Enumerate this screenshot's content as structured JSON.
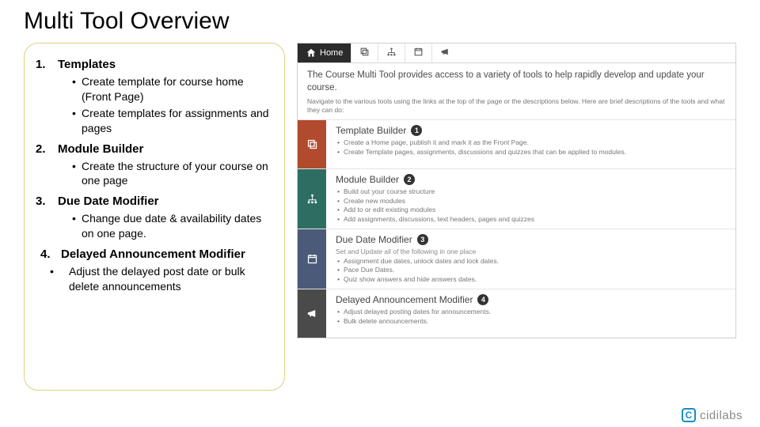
{
  "title": "Multi Tool Overview",
  "items": [
    {
      "num": "1.",
      "head": "Templates",
      "bullets": [
        "Create template for course home (Front Page)",
        "Create templates for assignments and pages"
      ]
    },
    {
      "num": "2.",
      "head": "Module Builder",
      "bullets": [
        "Create the structure of your course on one page"
      ]
    },
    {
      "num": "3.",
      "head": "Due Date Modifier",
      "bullets": [
        "Change due date & availability dates on one page."
      ]
    },
    {
      "num": "4.",
      "head": "Delayed Announcement Modifier",
      "bullets": [
        "Adjust the delayed post date or bulk delete announcements"
      ]
    }
  ],
  "screenshot": {
    "home_label": "Home",
    "intro": "The Course Multi Tool provides access to a variety of tools to help rapidly develop and update your course.",
    "subintro": "Navigate to the various tools using the links at the top of the page or the descriptions below. Here are brief descriptions of the tools and what they can do:",
    "sections": [
      {
        "title": "Template Builder",
        "badge": "1",
        "desc": "",
        "bullets": [
          "Create a Home page, publish it and mark it as the Front Page.",
          "Create Template pages, assignments, discussions and quizzes that can be applied to modules."
        ]
      },
      {
        "title": "Module Builder",
        "badge": "2",
        "desc": "",
        "bullets": [
          "Build out your course structure",
          "Create new modules",
          "Add to or edit existing modules",
          "Add assignments, discussions, text headers, pages and quizzes"
        ]
      },
      {
        "title": "Due Date Modifier",
        "badge": "3",
        "desc": "Set and Update all of the following in one place",
        "bullets": [
          "Assignment due dates, unlock dates and lock dates.",
          "Pace Due Dates.",
          "Quiz show answers and hide answers dates."
        ]
      },
      {
        "title": "Delayed Announcement Modifier",
        "badge": "4",
        "desc": "",
        "bullets": [
          "Adjust delayed posting dates for announcements.",
          "Bulk delete announcements."
        ]
      }
    ]
  },
  "logo": {
    "mark": "C",
    "text": "cidilabs"
  }
}
